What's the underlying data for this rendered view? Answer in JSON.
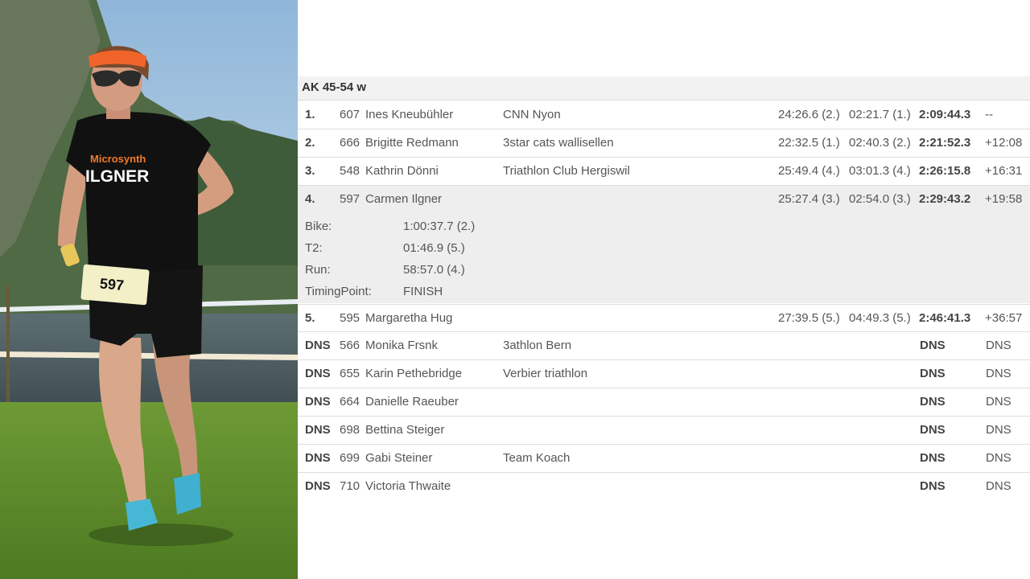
{
  "group": {
    "title": "AK 45-54 w"
  },
  "rows": [
    {
      "rank": "1.",
      "bib": "607",
      "name": "Ines Kneubühler",
      "club": "CNN Nyon",
      "swim": "24:26.6 (2.)",
      "t1": "02:21.7 (1.)",
      "total": "2:09:44.3",
      "diff": "--"
    },
    {
      "rank": "2.",
      "bib": "666",
      "name": "Brigitte Redmann",
      "club": "3star cats wallisellen",
      "swim": "22:32.5 (1.)",
      "t1": "02:40.3 (2.)",
      "total": "2:21:52.3",
      "diff": "+12:08"
    },
    {
      "rank": "3.",
      "bib": "548",
      "name": "Kathrin Dönni",
      "club": "Triathlon Club Hergiswil",
      "swim": "25:49.4 (4.)",
      "t1": "03:01.3 (4.)",
      "total": "2:26:15.8",
      "diff": "+16:31"
    },
    {
      "rank": "4.",
      "bib": "597",
      "name": "Carmen Ilgner",
      "club": "",
      "swim": "25:27.4 (3.)",
      "t1": "02:54.0 (3.)",
      "total": "2:29:43.2",
      "diff": "+19:58"
    },
    {
      "rank": "5.",
      "bib": "595",
      "name": "Margaretha Hug",
      "club": "",
      "swim": "27:39.5 (5.)",
      "t1": "04:49.3 (5.)",
      "total": "2:46:41.3",
      "diff": "+36:57"
    },
    {
      "rank": "DNS",
      "bib": "566",
      "name": "Monika Frsnk",
      "club": "3athlon Bern",
      "swim": "",
      "t1": "",
      "total": "DNS",
      "diff": "DNS"
    },
    {
      "rank": "DNS",
      "bib": "655",
      "name": "Karin Pethebridge",
      "club": "Verbier triathlon",
      "swim": "",
      "t1": "",
      "total": "DNS",
      "diff": "DNS"
    },
    {
      "rank": "DNS",
      "bib": "664",
      "name": "Danielle Raeuber",
      "club": "",
      "swim": "",
      "t1": "",
      "total": "DNS",
      "diff": "DNS"
    },
    {
      "rank": "DNS",
      "bib": "698",
      "name": "Bettina Steiger",
      "club": "",
      "swim": "",
      "t1": "",
      "total": "DNS",
      "diff": "DNS"
    },
    {
      "rank": "DNS",
      "bib": "699",
      "name": "Gabi Steiner",
      "club": "Team Koach",
      "swim": "",
      "t1": "",
      "total": "DNS",
      "diff": "DNS"
    },
    {
      "rank": "DNS",
      "bib": "710",
      "name": "Victoria Thwaite",
      "club": "",
      "swim": "",
      "t1": "",
      "total": "DNS",
      "diff": "DNS"
    }
  ],
  "details": [
    {
      "label": "Bike:",
      "value": "1:00:37.7 (2.)"
    },
    {
      "label": "T2:",
      "value": "01:46.9 (5.)"
    },
    {
      "label": "Run:",
      "value": "58:57.0 (4.)"
    },
    {
      "label": "TimingPoint:",
      "value": "FINISH"
    }
  ],
  "photo": {
    "jersey_sponsor": "Microsynth",
    "jersey_name": "ILGNER",
    "bib_number": "597",
    "colors": {
      "sky": "#a9c6e0",
      "grass": "#5f8a2c",
      "visor": "#f0642a",
      "kit": "#111111",
      "shoes": "#3fb8d8"
    }
  }
}
